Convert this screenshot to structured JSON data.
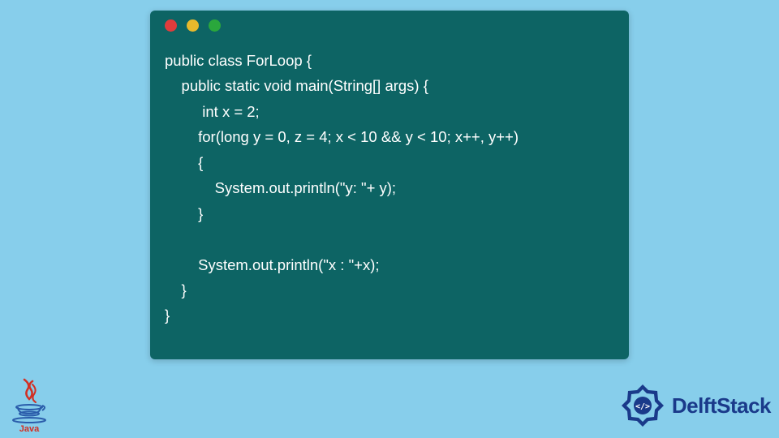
{
  "window": {
    "dots": [
      "red",
      "yellow",
      "green"
    ]
  },
  "code": {
    "line1": "public class ForLoop {",
    "line2": "    public static void main(String[] args) {",
    "line3": "         int x = 2;",
    "line4": "        for(long y = 0, z = 4; x < 10 && y < 10; x++, y++)",
    "line5": "        {",
    "line6": "            System.out.println(\"y: \"+ y);",
    "line7": "        }",
    "line8": "",
    "line9": "        System.out.println(\"x : \"+x);",
    "line10": "    }",
    "line11": "}"
  },
  "logos": {
    "java": "Java",
    "delft": "DelftStack"
  },
  "colors": {
    "background": "#87ceeb",
    "window": "#0d6464",
    "code_text": "#ffffff",
    "delft_blue": "#1a3a8a"
  }
}
